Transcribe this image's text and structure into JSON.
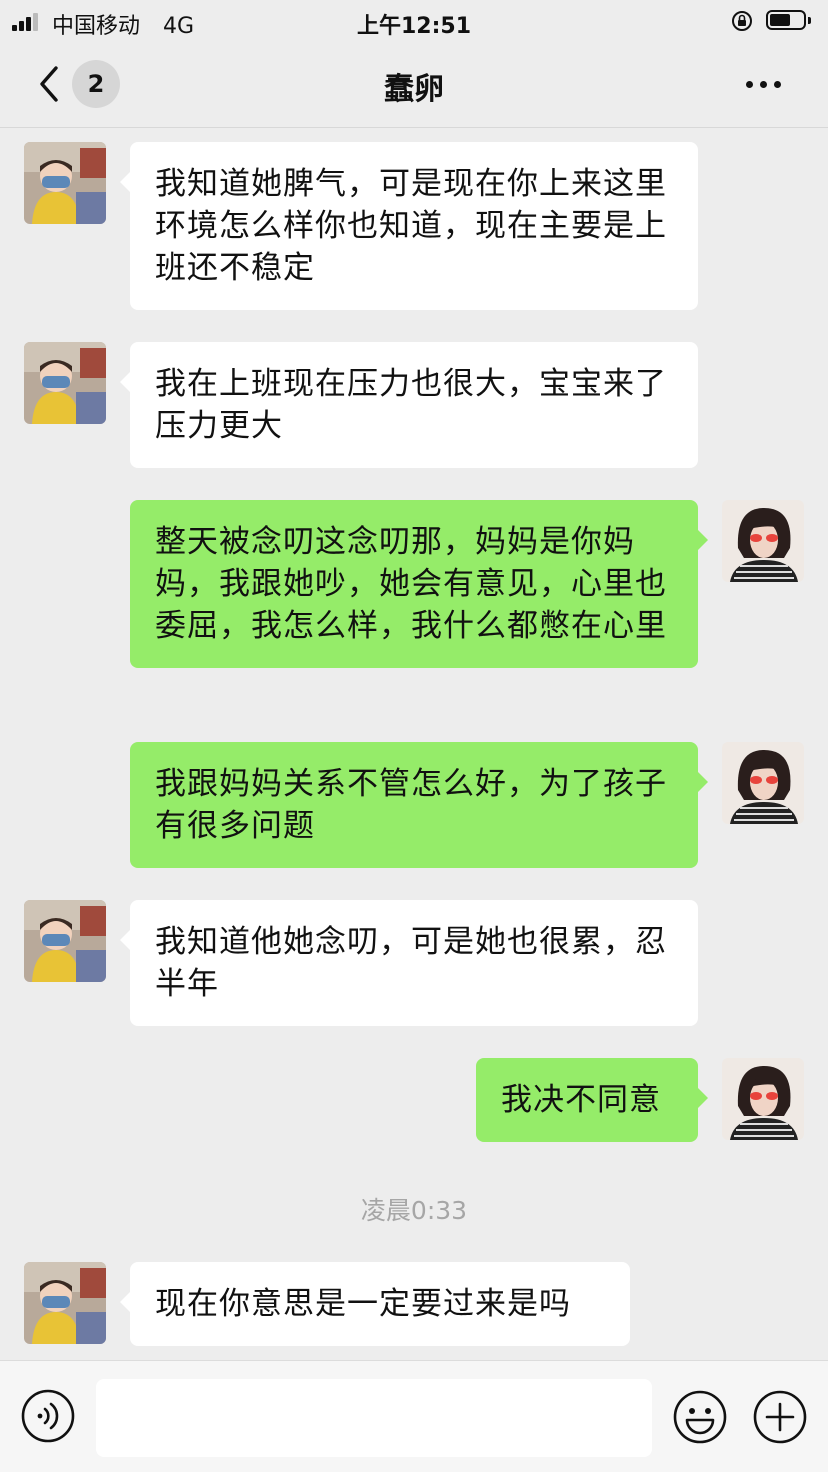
{
  "status_bar": {
    "carrier": "中国移动",
    "network": "4G",
    "time": "上午12:51"
  },
  "header": {
    "unread_count": "2",
    "title": "蠢卵",
    "back_icon": "chevron-left-icon",
    "more_icon": "more-dots-icon"
  },
  "messages": [
    {
      "side": "in",
      "text": "我知道她脾气，可是现在你上来这里环境怎么样你也知道，现在主要是上班还不稳定"
    },
    {
      "side": "in",
      "text": "我在上班现在压力也很大，宝宝来了压力更大"
    },
    {
      "side": "out",
      "text": "整天被念叨这念叨那，妈妈是你妈妈，我跟她吵，她会有意见，心里也委屈，我怎么样，我什么都憋在心里"
    },
    {
      "side": "out",
      "text": "我跟妈妈关系不管怎么好，为了孩子有很多问题"
    },
    {
      "side": "in",
      "text": "我知道他她念叨，可是她也很累，忍半年"
    },
    {
      "side": "out",
      "text": "我决不同意"
    },
    {
      "side": "in",
      "text": "现在你意思是一定要过来是吗"
    }
  ],
  "timestamp": "凌晨0:33",
  "input_bar": {
    "voice_icon": "voice-icon",
    "emoji_icon": "emoji-icon",
    "plus_icon": "plus-icon",
    "placeholder": ""
  },
  "colors": {
    "background": "#ededed",
    "incoming_bubble": "#ffffff",
    "outgoing_bubble": "#95ec69",
    "timestamp_text": "#a6a6a6"
  }
}
